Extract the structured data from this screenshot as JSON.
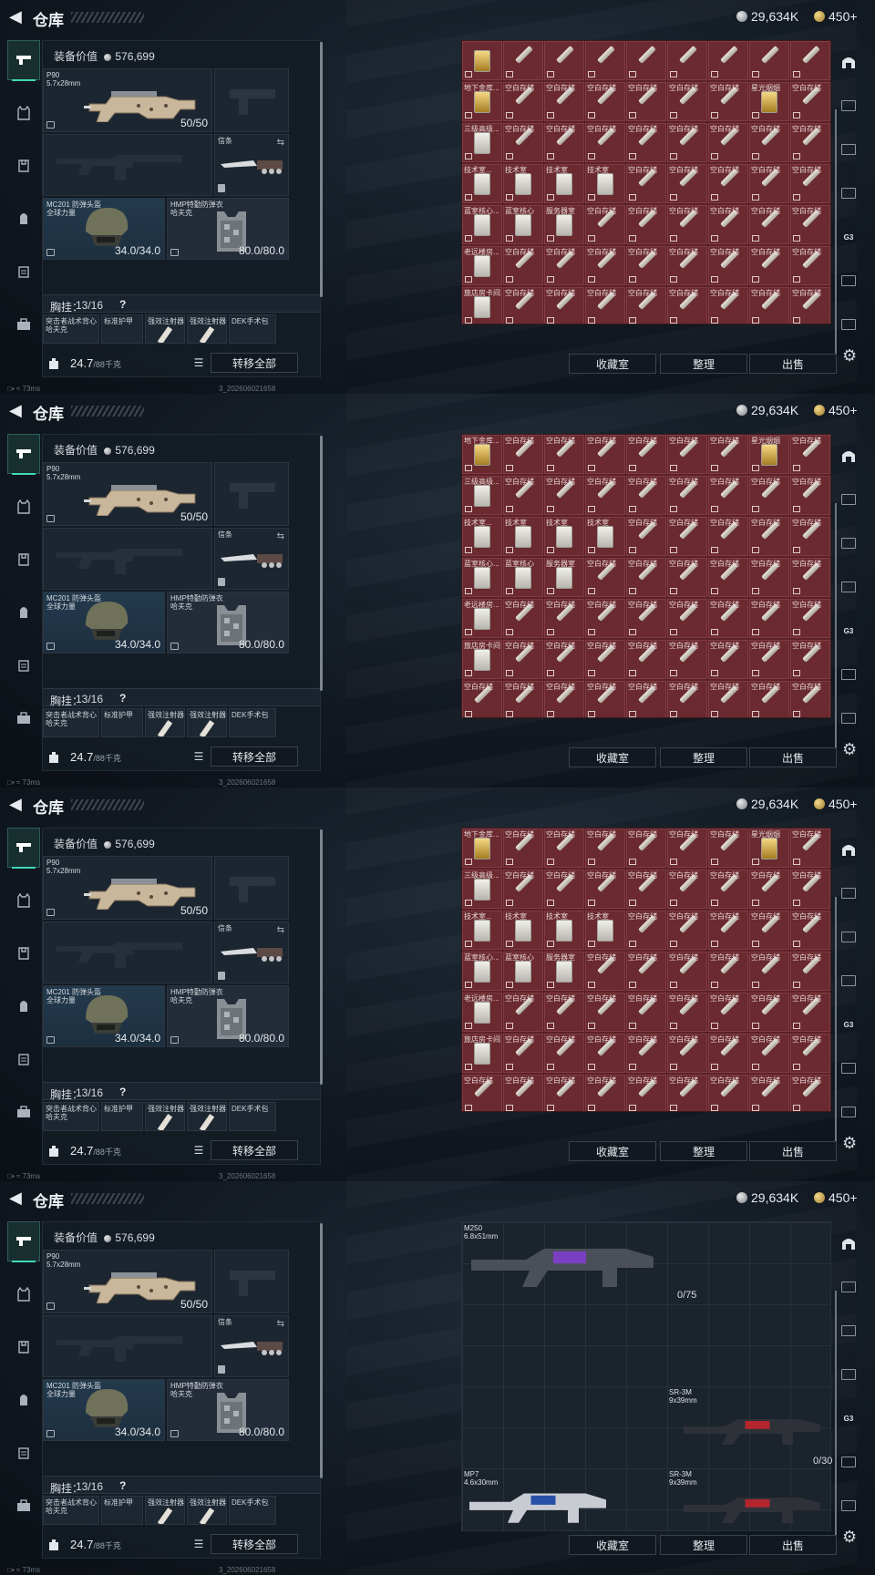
{
  "header": {
    "title": "仓库",
    "silver": "29,634K",
    "gold": "450",
    "gold_plus": "+"
  },
  "loadout": {
    "value_label": "装备价值",
    "value": "576,699",
    "primary": {
      "name": "P90",
      "caliber": "5.7x28mm",
      "ammo": "50/50"
    },
    "melee": {
      "name": "信条"
    },
    "helmet": {
      "name": "MC201 防弹头盔",
      "sub": "全球力量",
      "durability": "34.0/34.0"
    },
    "armor": {
      "name": "HMP特勤防弹衣",
      "sub": "哈夫克",
      "durability": "80.0/80.0"
    },
    "chest_label": "胸挂：",
    "chest_slots": "13/16",
    "chest_q": "?",
    "rig_items": [
      "突击者战术背心 哈夫克",
      "标准护甲",
      "强效注射器",
      "强效注射器",
      "DEK手术包"
    ],
    "weight": "24.7",
    "weight_max": "/88千克",
    "transfer_all": "转移全部"
  },
  "actions": {
    "collection": "收藏室",
    "sort": "整理",
    "sell": "出售"
  },
  "status": {
    "ping": "73ms",
    "build": "3_202606021658"
  },
  "grid_labels": {
    "blank": "空白存储",
    "r1c0": "地下金库...",
    "r1c7": "星光烟烟",
    "r2c0": "三级高级...",
    "r3c0": "技术室...",
    "r3c1": "技术室",
    "r3c2": "技术室",
    "r3c3": "技术室",
    "r4c0": "蓝室核心...",
    "r4c1": "蓝室核心",
    "r4c2": "服务器室",
    "r5c0": "老远楼房...",
    "r6c0": "旅店房卡间"
  },
  "weapons_panel": [
    {
      "name": "M250",
      "caliber": "6.8x51mm",
      "ammo": "0/75"
    },
    {
      "name": "SR-3M",
      "caliber": "9x39mm",
      "ammo": "0/30"
    },
    {
      "name": "MP7",
      "caliber": "4.6x30mm",
      "ammo": ""
    },
    {
      "name": "SR-3M",
      "caliber": "9x39mm",
      "ammo": ""
    }
  ],
  "colors": {
    "accent": "#3ed9b6",
    "grid_bg": "#6a2a2f",
    "panel": "#1c2631"
  }
}
